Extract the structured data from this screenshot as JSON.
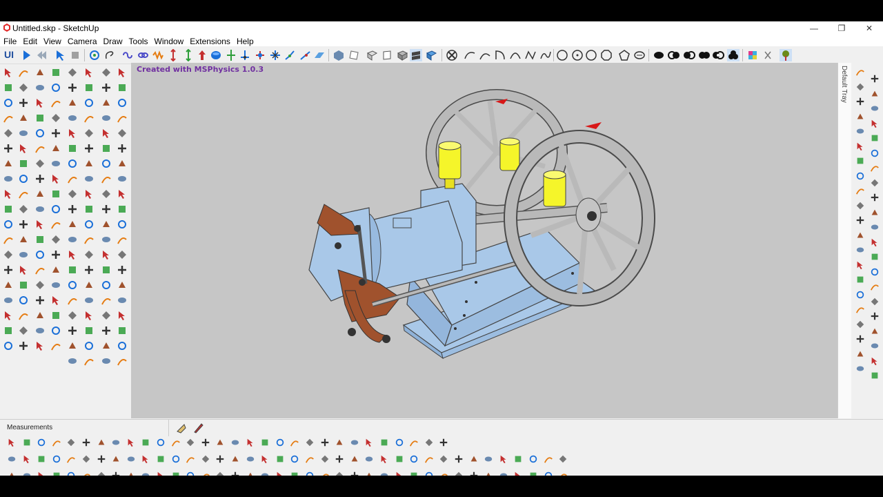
{
  "window": {
    "title": "Untitled.skp - SketchUp",
    "controls": {
      "minimize": "—",
      "restore": "❐",
      "close": "✕"
    }
  },
  "menu": [
    "File",
    "Edit",
    "View",
    "Camera",
    "Draw",
    "Tools",
    "Window",
    "Extensions",
    "Help"
  ],
  "toolbar": {
    "ui_label": "UI"
  },
  "viewport": {
    "credit": "Created with MSPhysics 1.0.3",
    "background": "#c6c6c6"
  },
  "tray": {
    "label": "Default Tray"
  },
  "status": {
    "measurements_label": "Measurements"
  },
  "colors": {
    "engine_blue": "#a9c8e8",
    "rust": "#a0522d",
    "flywheel_gray": "#b9b9b9",
    "oil_cup_yellow": "#f5f52a",
    "marker_red": "#d81818",
    "credit_purple": "#7030a0"
  }
}
